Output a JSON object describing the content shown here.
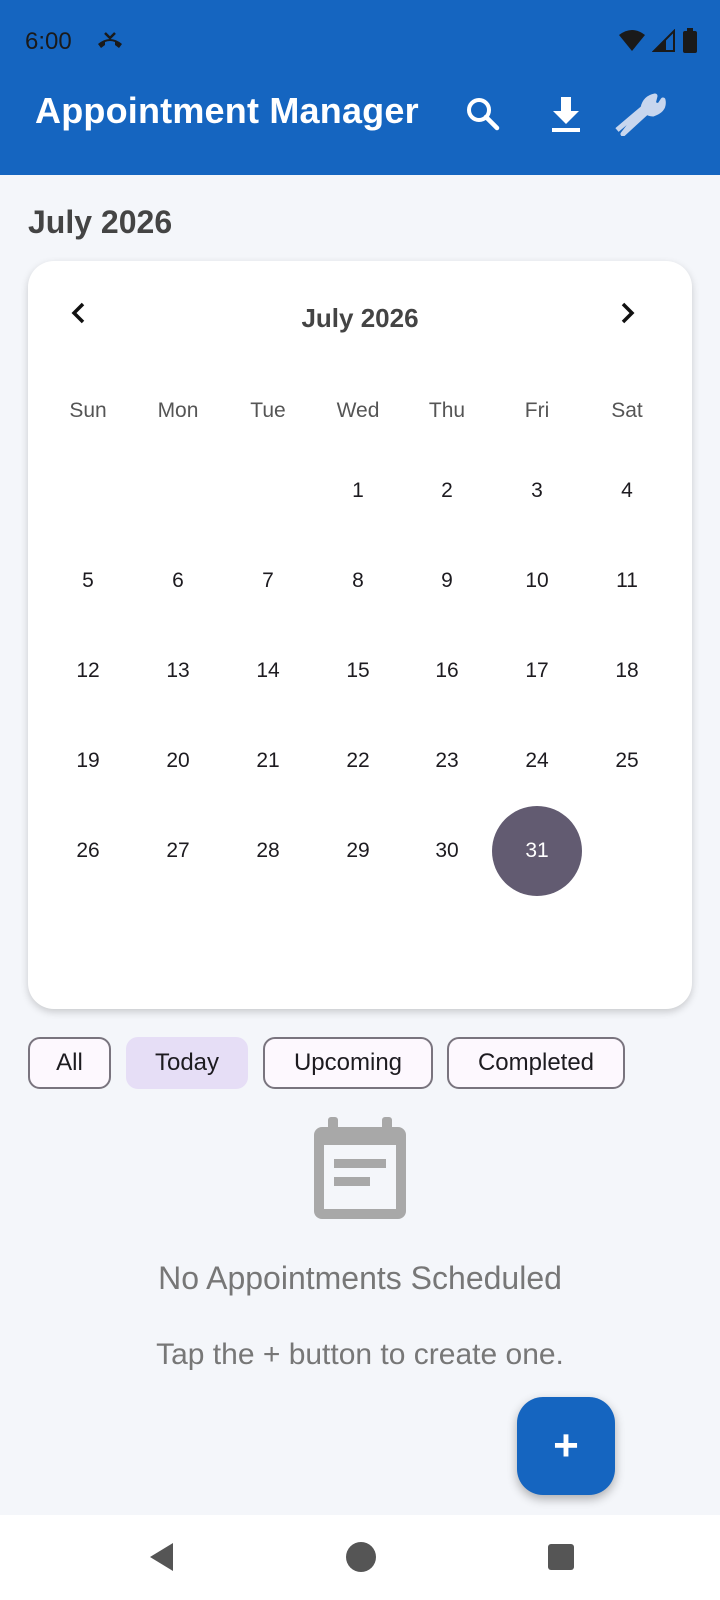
{
  "status_bar": {
    "time": "6:00",
    "icons": [
      "missed-call-icon",
      "wifi-icon",
      "signal-icon",
      "battery-icon"
    ]
  },
  "app_bar": {
    "title": "Appointment Manager",
    "actions": [
      "search-icon",
      "download-icon",
      "wrench-icon"
    ],
    "color": "#1565c0"
  },
  "month_heading": "July 2026",
  "calendar": {
    "title": "July 2026",
    "weekdays": [
      "Sun",
      "Mon",
      "Tue",
      "Wed",
      "Thu",
      "Fri",
      "Sat"
    ],
    "days": [
      "1",
      "2",
      "3",
      "4",
      "5",
      "6",
      "7",
      "8",
      "9",
      "10",
      "11",
      "12",
      "13",
      "14",
      "15",
      "16",
      "17",
      "18",
      "19",
      "20",
      "21",
      "22",
      "23",
      "24",
      "25",
      "26",
      "27",
      "28",
      "29",
      "30",
      "31"
    ],
    "selected_day": "31",
    "selected_color": "#625b71"
  },
  "filters": {
    "all": "All",
    "today": "Today",
    "upcoming": "Upcoming",
    "completed": "Completed",
    "active": "Today"
  },
  "empty_state": {
    "icon": "calendar-icon",
    "title": "No Appointments Scheduled",
    "subtitle": "Tap the + button to create one."
  },
  "fab": {
    "label": "+"
  },
  "nav_bar": {
    "icons": [
      "back-icon",
      "home-icon",
      "recents-icon"
    ]
  }
}
